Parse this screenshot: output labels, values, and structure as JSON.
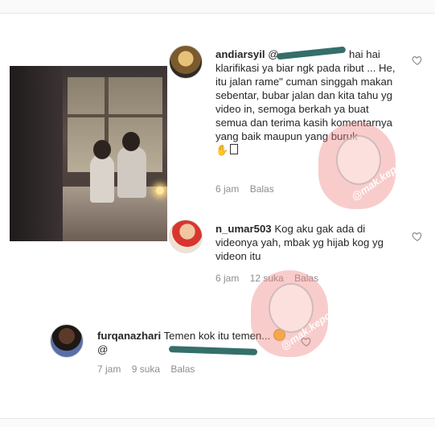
{
  "comments": [
    {
      "username": "andiarsyil",
      "mention_prefix": "@",
      "text": "hai hai klarifikasi ya biar ngk pada ribut ... He, itu jalan rame\" cuman singgah makan sebentar, bubar jalan dan kita tahu yg video in, semoga berkah ya buat semua dan terima kasih komentarnya yang baik maupun yang buruk",
      "time": "6 jam",
      "reply": "Balas",
      "likes": ""
    },
    {
      "username": "n_umar503",
      "text": "Kog aku gak ada di videonya yah, mbak yg hijab kog yg videon itu",
      "time": "6 jam",
      "likes": "12 suka",
      "reply": "Balas"
    },
    {
      "username": "furqanazhari",
      "text": "Temen kok itu temen...",
      "mention_prefix": "@",
      "time": "7 jam",
      "likes": "9 suka",
      "reply": "Balas"
    }
  ],
  "watermark": {
    "text": "@mak.kepo"
  },
  "icons": {
    "like": "heart-icon",
    "emoji1": "hand-emoji-icon",
    "emoji2": "grin-emoji-icon"
  },
  "colors": {
    "text": "#262626",
    "meta": "#8e8e8e",
    "watermark": "#f07878"
  }
}
